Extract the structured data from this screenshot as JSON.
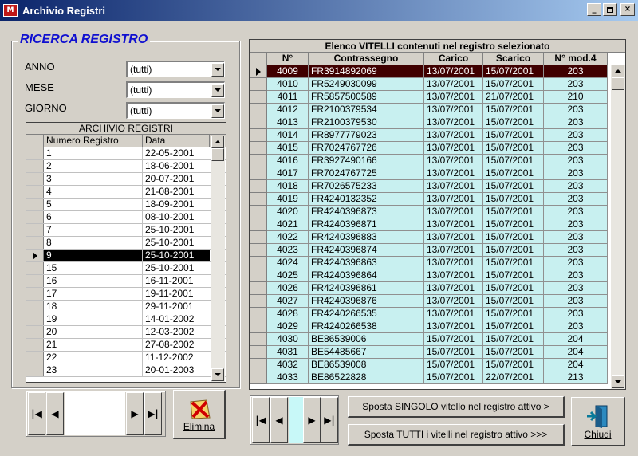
{
  "window": {
    "title": "Archivio Registri",
    "icon": "app-logo-icon"
  },
  "search": {
    "title": "RICERCA REGISTRO",
    "fields": [
      {
        "label": "ANNO",
        "value": "(tutti)"
      },
      {
        "label": "MESE",
        "value": "(tutti)"
      },
      {
        "label": "GIORNO",
        "value": "(tutti)"
      }
    ]
  },
  "archive": {
    "caption": "ARCHIVIO REGISTRI",
    "columns": [
      "Numero Registro",
      "Data"
    ],
    "selected_index": 8,
    "rows": [
      [
        "1",
        "22-05-2001"
      ],
      [
        "2",
        "18-06-2001"
      ],
      [
        "3",
        "20-07-2001"
      ],
      [
        "4",
        "21-08-2001"
      ],
      [
        "5",
        "18-09-2001"
      ],
      [
        "6",
        "08-10-2001"
      ],
      [
        "7",
        "25-10-2001"
      ],
      [
        "8",
        "25-10-2001"
      ],
      [
        "9",
        "25-10-2001"
      ],
      [
        "15",
        "25-10-2001"
      ],
      [
        "16",
        "16-11-2001"
      ],
      [
        "17",
        "19-11-2001"
      ],
      [
        "18",
        "29-11-2001"
      ],
      [
        "19",
        "14-01-2002"
      ],
      [
        "20",
        "12-03-2002"
      ],
      [
        "21",
        "27-08-2002"
      ],
      [
        "22",
        "11-12-2002"
      ],
      [
        "23",
        "20-01-2003"
      ]
    ]
  },
  "buttons": {
    "delete": "Elimina",
    "close": "Chiudi",
    "move_single": "Sposta SINGOLO vitello nel registro attivo >",
    "move_all": "Sposta TUTTI i vitelli nel registro attivo >>>"
  },
  "calves": {
    "caption": "Elenco VITELLI contenuti nel registro selezionato",
    "columns": [
      "N°",
      "Contrassegno",
      "Carico",
      "Scarico",
      "N° mod.4"
    ],
    "selected_index": 0,
    "rows": [
      [
        "4009",
        "FR3914892069",
        "13/07/2001",
        "15/07/2001",
        "203"
      ],
      [
        "4010",
        "FR5249030099",
        "13/07/2001",
        "15/07/2001",
        "203"
      ],
      [
        "4011",
        "FR5857500589",
        "13/07/2001",
        "21/07/2001",
        "210"
      ],
      [
        "4012",
        "FR2100379534",
        "13/07/2001",
        "15/07/2001",
        "203"
      ],
      [
        "4013",
        "FR2100379530",
        "13/07/2001",
        "15/07/2001",
        "203"
      ],
      [
        "4014",
        "FR8977779023",
        "13/07/2001",
        "15/07/2001",
        "203"
      ],
      [
        "4015",
        "FR7024767726",
        "13/07/2001",
        "15/07/2001",
        "203"
      ],
      [
        "4016",
        "FR3927490166",
        "13/07/2001",
        "15/07/2001",
        "203"
      ],
      [
        "4017",
        "FR7024767725",
        "13/07/2001",
        "15/07/2001",
        "203"
      ],
      [
        "4018",
        "FR7026575233",
        "13/07/2001",
        "15/07/2001",
        "203"
      ],
      [
        "4019",
        "FR4240132352",
        "13/07/2001",
        "15/07/2001",
        "203"
      ],
      [
        "4020",
        "FR4240396873",
        "13/07/2001",
        "15/07/2001",
        "203"
      ],
      [
        "4021",
        "FR4240396871",
        "13/07/2001",
        "15/07/2001",
        "203"
      ],
      [
        "4022",
        "FR4240396883",
        "13/07/2001",
        "15/07/2001",
        "203"
      ],
      [
        "4023",
        "FR4240396874",
        "13/07/2001",
        "15/07/2001",
        "203"
      ],
      [
        "4024",
        "FR4240396863",
        "13/07/2001",
        "15/07/2001",
        "203"
      ],
      [
        "4025",
        "FR4240396864",
        "13/07/2001",
        "15/07/2001",
        "203"
      ],
      [
        "4026",
        "FR4240396861",
        "13/07/2001",
        "15/07/2001",
        "203"
      ],
      [
        "4027",
        "FR4240396876",
        "13/07/2001",
        "15/07/2001",
        "203"
      ],
      [
        "4028",
        "FR4240266535",
        "13/07/2001",
        "15/07/2001",
        "203"
      ],
      [
        "4029",
        "FR4240266538",
        "13/07/2001",
        "15/07/2001",
        "203"
      ],
      [
        "4030",
        "BE86539006",
        "15/07/2001",
        "15/07/2001",
        "204"
      ],
      [
        "4031",
        "BE54485667",
        "15/07/2001",
        "15/07/2001",
        "204"
      ],
      [
        "4032",
        "BE86539008",
        "15/07/2001",
        "15/07/2001",
        "204"
      ],
      [
        "4033",
        "BE86522828",
        "15/07/2001",
        "22/07/2001",
        "213"
      ]
    ]
  },
  "colors": {
    "title_start": "#0a246a",
    "title_end": "#a6caf0",
    "group_title": "#1010d0",
    "row_bg": "#c8f0f0",
    "selected_calf": "#400000",
    "selected_register": "#000000"
  }
}
